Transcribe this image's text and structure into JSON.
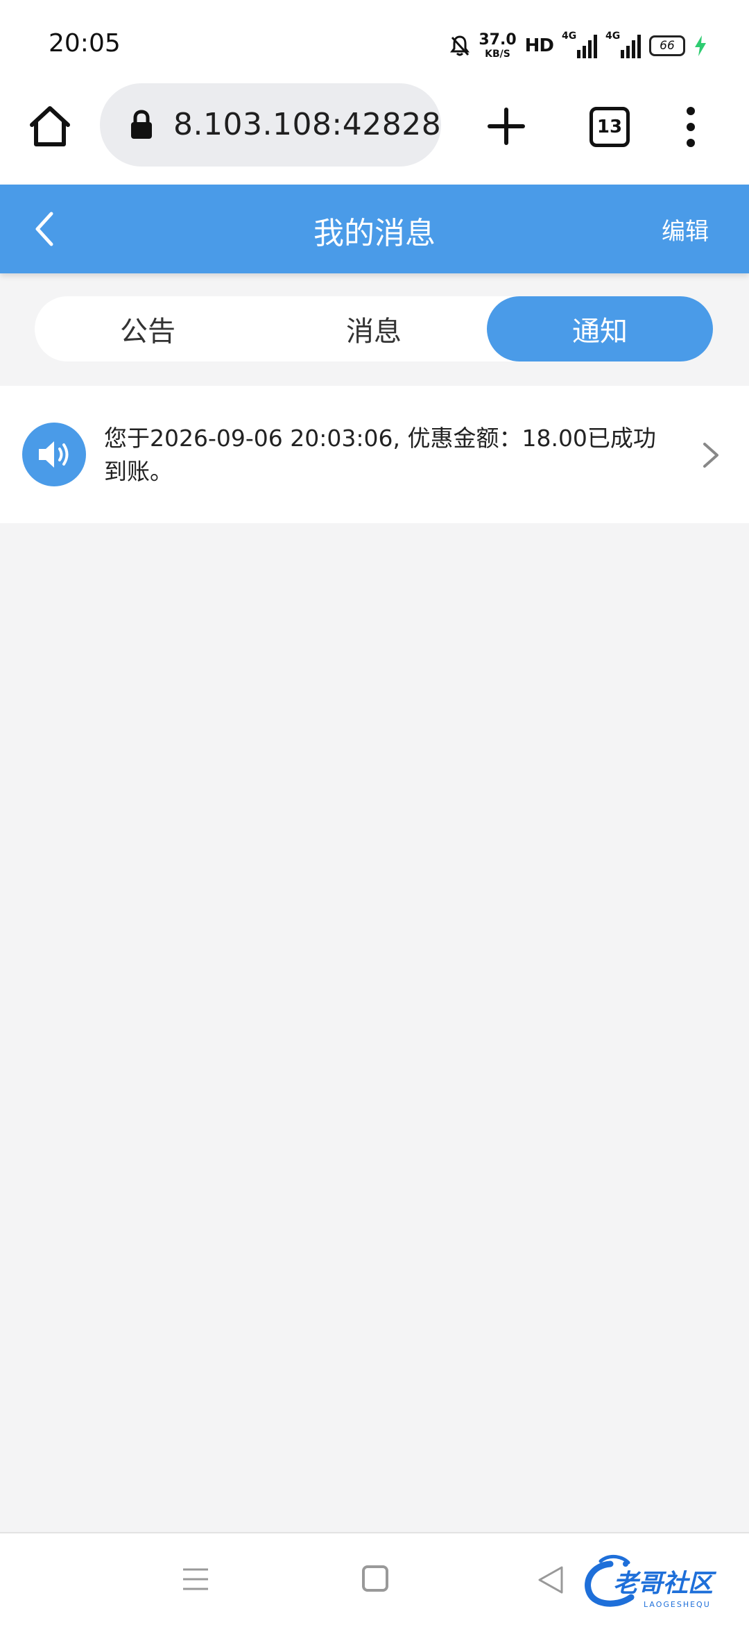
{
  "status_bar": {
    "time": "20:05",
    "net_speed": "37.0",
    "net_speed_unit": "KB/S",
    "hd_label": "HD",
    "signal1_label": "4G",
    "signal2_label": "4G",
    "battery": "66",
    "icons": [
      "bell-off-icon",
      "signal-icon",
      "signal-icon",
      "battery-icon",
      "charging-icon"
    ]
  },
  "browser": {
    "url": "8.103.108:42828",
    "tab_count": "13",
    "icons": [
      "home-icon",
      "lock-icon",
      "plus-icon",
      "more-vert-icon"
    ]
  },
  "header": {
    "title": "我的消息",
    "edit_label": "编辑",
    "accent_color": "#4a9be8"
  },
  "tabs": [
    {
      "label": "公告",
      "active": false
    },
    {
      "label": "消息",
      "active": false
    },
    {
      "label": "通知",
      "active": true
    }
  ],
  "messages": [
    {
      "icon": "speaker-icon",
      "text": "您于2026-09-06 20:03:06, 优惠金额：18.00已成功到账。"
    }
  ],
  "nav_bar": {
    "icons": [
      "menu-icon",
      "home-square-icon",
      "back-triangle-icon"
    ],
    "watermark": "老哥社区",
    "watermark_sub": "LAOGESHEQU"
  }
}
